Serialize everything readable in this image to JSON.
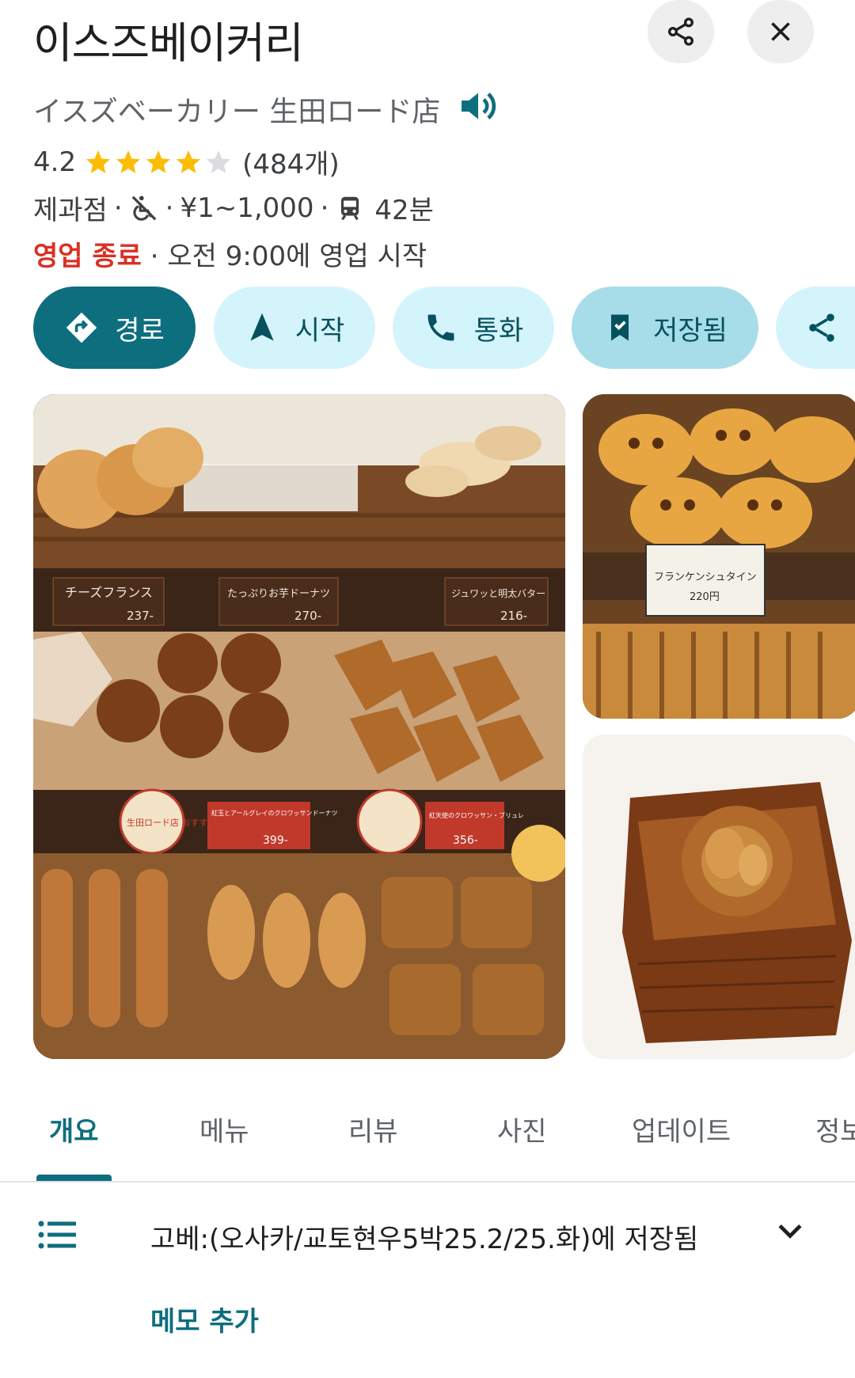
{
  "place": {
    "title": "이스즈베이커리",
    "subtitle": "イスズベーカリー 生田ロード店",
    "rating": "4.2",
    "rating_value": 4.2,
    "review_count": "(484개)",
    "category": "제과점",
    "price": "¥1~1,000",
    "transit_time": "42분",
    "status_closed": "영업 종료",
    "status_next": "· 오전 9:00에 영업 시작"
  },
  "actions": {
    "directions": "경로",
    "start": "시작",
    "call": "통화",
    "saved": "저장됨"
  },
  "tabs": [
    "개요",
    "메뉴",
    "리뷰",
    "사진",
    "업데이트",
    "정보"
  ],
  "saved_list": {
    "text": "고베:(오사카/교토현우5박25.2/25.화)에 저장됨",
    "memo": "메모 추가"
  },
  "photos": {
    "main_labels": [
      "チーズフランス",
      "237-",
      "たっぷりお芋ドーナツ",
      "270-",
      "ジュワッと明太バター",
      "216-",
      "生田ロード店 おすすめ",
      "紅玉とアールグレイのクロワッサンドーナツ",
      "399-",
      "紅天使のクロワッサン・ブリュレ",
      "356-"
    ],
    "p2_labels": [
      "フランケンシュタイン",
      "220円"
    ]
  },
  "colors": {
    "accent": "#0d6e7e",
    "chip": "#d4f4fb",
    "chip_saved": "#a7dde8",
    "closed": "#d93025",
    "star": "#fbbc04"
  }
}
